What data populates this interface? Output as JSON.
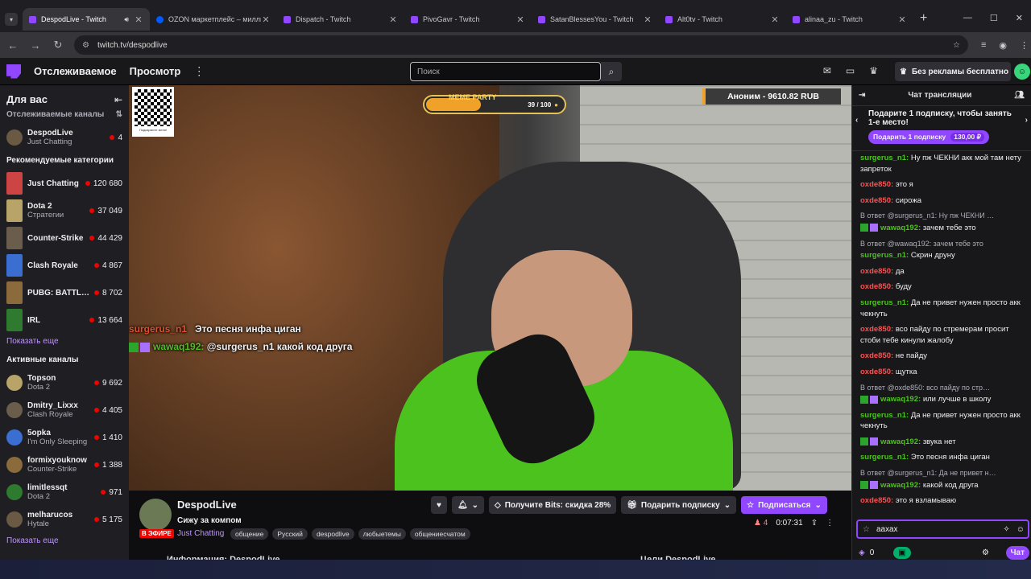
{
  "browser": {
    "tabs": [
      {
        "title": "DespodLive - Twitch",
        "active": true
      },
      {
        "title": "OZON маркетплейс – миллио",
        "active": false
      },
      {
        "title": "Dispatch - Twitch",
        "active": false
      },
      {
        "title": "PivoGavr - Twitch",
        "active": false
      },
      {
        "title": "SatanBlessesYou - Twitch",
        "active": false
      },
      {
        "title": "Alt0tv - Twitch",
        "active": false
      },
      {
        "title": "alinaa_zu - Twitch",
        "active": false
      }
    ],
    "url": "twitch.tv/despodlive"
  },
  "topnav": {
    "following": "Отслеживаемое",
    "browse": "Просмотр",
    "search_placeholder": "Поиск",
    "no_ads": "Без рекламы бесплатно"
  },
  "sidebar": {
    "title": "Для вас",
    "followed_header": "Отслеживаемые каналы",
    "followed": [
      {
        "name": "DespodLive",
        "game": "Just Chatting",
        "viewers": "4"
      }
    ],
    "recommended_header": "Рекомендуемые категории",
    "categories": [
      {
        "name": "Just Chatting",
        "sub": "",
        "viewers": "120 680"
      },
      {
        "name": "Dota 2",
        "sub": "Стратегии",
        "viewers": "37 049"
      },
      {
        "name": "Counter-Strike",
        "sub": "",
        "viewers": "44 429"
      },
      {
        "name": "Clash Royale",
        "sub": "",
        "viewers": "4 867"
      },
      {
        "name": "PUBG: BATTLEG…",
        "sub": "",
        "viewers": "8 702"
      },
      {
        "name": "IRL",
        "sub": "",
        "viewers": "13 664"
      }
    ],
    "show_more": "Показать еще",
    "active_header": "Активные каналы",
    "active": [
      {
        "name": "Topson",
        "game": "Dota 2",
        "viewers": "9 692"
      },
      {
        "name": "Dmitry_Lixxx",
        "game": "Clash Royale",
        "viewers": "4 405"
      },
      {
        "name": "5opka",
        "game": "I'm Only Sleeping",
        "viewers": "1 410"
      },
      {
        "name": "formixyouknow",
        "game": "Counter-Strike",
        "viewers": "1 388"
      },
      {
        "name": "limitlessqt",
        "game": "Dota 2",
        "viewers": "971"
      },
      {
        "name": "melharucos",
        "game": "Hytale",
        "viewers": "5 175"
      }
    ],
    "show_more2": "Показать еще"
  },
  "video": {
    "qr_caption": "Подкармите меня!",
    "meme_label": "MEME PARTY",
    "meme_progress": "39 / 100",
    "meme_fraction": 0.39,
    "donation": "Аноним - 9610.82 RUB",
    "overlay_chat": [
      {
        "user": "surgerus_n1",
        "text": "Это песня инфа циган"
      },
      {
        "user": "wawaq192:",
        "text": "@surgerus_n1 какой код друга"
      }
    ]
  },
  "stream": {
    "name": "DespodLive",
    "title": "Сижу за компом",
    "live": "В ЭФИРЕ",
    "category": "Just Chatting",
    "tags": [
      "общение",
      "Русский",
      "despodlive",
      "любыетемы",
      "общениесчатом"
    ],
    "bits": "Получите Bits: скидка 28%",
    "gift_sub": "Подарить подписку",
    "subscribe": "Подписаться",
    "viewers": "4",
    "uptime": "0:07:31",
    "about": "Информация: DespodLive",
    "goals": "Цели DespodLive"
  },
  "chat": {
    "title": "Чат трансляции",
    "gift_text": "Подарите 1 подписку, чтобы занять 1-е место!",
    "gift_btn": "Подарить 1 подписку",
    "gift_price": "130,00 ₽",
    "input_value": "аахах",
    "points": "0",
    "chat_btn": "Чат",
    "messages": [
      {
        "reply": "",
        "user": "surgerus_n1:",
        "color": "g",
        "badges": false,
        "text": "Ну пж ЧЕКНИ акк мой там нету запреток"
      },
      {
        "reply": "",
        "user": "oxde850:",
        "color": "r",
        "badges": false,
        "text": "это я"
      },
      {
        "reply": "",
        "user": "oxde850:",
        "color": "r",
        "badges": false,
        "text": "сирожа"
      },
      {
        "reply": "В ответ @surgerus_n1: Ну пж ЧЕКНИ …",
        "user": "wawaq192:",
        "color": "g",
        "badges": true,
        "text": "зачем тебе это"
      },
      {
        "reply": "В ответ @wawaq192: зачем тебе это",
        "user": "surgerus_n1:",
        "color": "g",
        "badges": false,
        "text": "Скрин друну"
      },
      {
        "reply": "",
        "user": "oxde850:",
        "color": "r",
        "badges": false,
        "text": "да"
      },
      {
        "reply": "",
        "user": "oxde850:",
        "color": "r",
        "badges": false,
        "text": "буду"
      },
      {
        "reply": "",
        "user": "surgerus_n1:",
        "color": "g",
        "badges": false,
        "text": "Да не привет нужен просто акк чекнуть"
      },
      {
        "reply": "",
        "user": "oxde850:",
        "color": "r",
        "badges": false,
        "text": "всо пайду по стремерам просит стоби тебе кинули жалобу"
      },
      {
        "reply": "",
        "user": "oxde850:",
        "color": "r",
        "badges": false,
        "text": "не пайду"
      },
      {
        "reply": "",
        "user": "oxde850:",
        "color": "r",
        "badges": false,
        "text": "щутка"
      },
      {
        "reply": "В ответ @oxde850: всо пайду по стр…",
        "user": "wawaq192:",
        "color": "g",
        "badges": true,
        "text": "или лучше в школу"
      },
      {
        "reply": "",
        "user": "surgerus_n1:",
        "color": "g",
        "badges": false,
        "text": "Да не привет нужен просто акк чекнуть"
      },
      {
        "reply": "",
        "user": "wawaq192:",
        "color": "g",
        "badges": true,
        "text": "звука нет"
      },
      {
        "reply": "",
        "user": "surgerus_n1:",
        "color": "g",
        "badges": false,
        "text": "Это песня инфа циган"
      },
      {
        "reply": "В ответ @surgerus_n1: Да не привет н…",
        "user": "wawaq192:",
        "color": "g",
        "badges": true,
        "text": "какой код друга"
      },
      {
        "reply": "",
        "user": "oxde850:",
        "color": "r",
        "badges": false,
        "text": "это я взламываю"
      }
    ]
  }
}
